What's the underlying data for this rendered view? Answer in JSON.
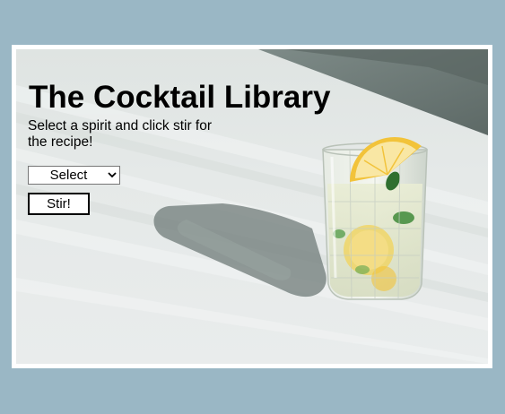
{
  "header": {
    "title": "The Cocktail Library",
    "subtitle": "Select a spirit and click stir for the recipe!"
  },
  "controls": {
    "spirit_select_value": "Select",
    "stir_label": "Stir!"
  },
  "colors": {
    "page_background": "#9ab7c5",
    "frame": "#ffffff",
    "table_surface": "#e5e9e8",
    "shadow": "#6f7b78",
    "lemon": "#f2c33a",
    "mint": "#3f8a3a"
  }
}
